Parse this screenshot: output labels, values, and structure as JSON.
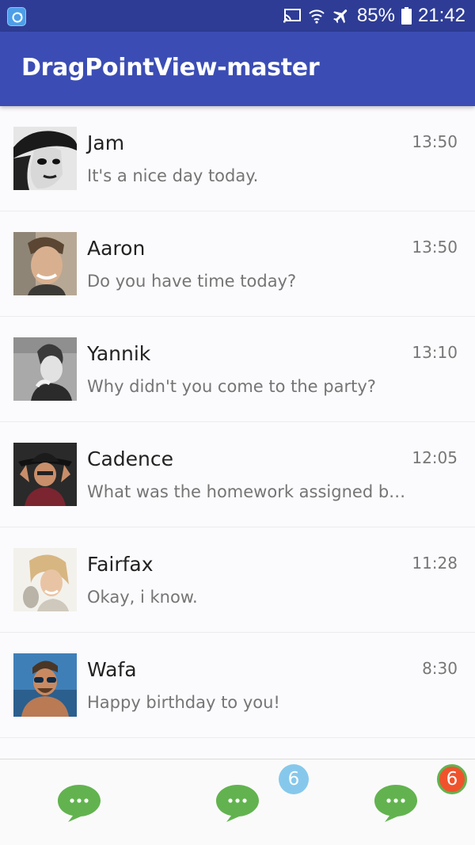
{
  "status_bar": {
    "battery": "85%",
    "time": "21:42"
  },
  "toolbar": {
    "title": "DragPointView-master"
  },
  "conversations": [
    {
      "name": "Jam",
      "message": "It's a nice day today.",
      "time": "13:50"
    },
    {
      "name": "Aaron",
      "message": "Do you have time today?",
      "time": "13:50"
    },
    {
      "name": "Yannik",
      "message": "Why didn't you come to the party?",
      "time": "13:10"
    },
    {
      "name": "Cadence",
      "message": "What was the homework assigned by the teacher today?",
      "time": "12:05"
    },
    {
      "name": "Fairfax",
      "message": "Okay, i know.",
      "time": "11:28"
    },
    {
      "name": "Wafa",
      "message": "Happy birthday to you!",
      "time": "8:30"
    }
  ],
  "bottom_tabs": [
    {
      "icon": "chat-bubble-icon",
      "badge": ""
    },
    {
      "icon": "chat-bubble-icon",
      "badge": "6"
    },
    {
      "icon": "chat-bubble-icon",
      "badge": "6"
    }
  ],
  "colors": {
    "status_bar": "#2e3c95",
    "toolbar": "#3b4db4",
    "chat_icon": "#62b34f",
    "badge_blue": "#86c8ec",
    "badge_red": "#f0532c"
  }
}
